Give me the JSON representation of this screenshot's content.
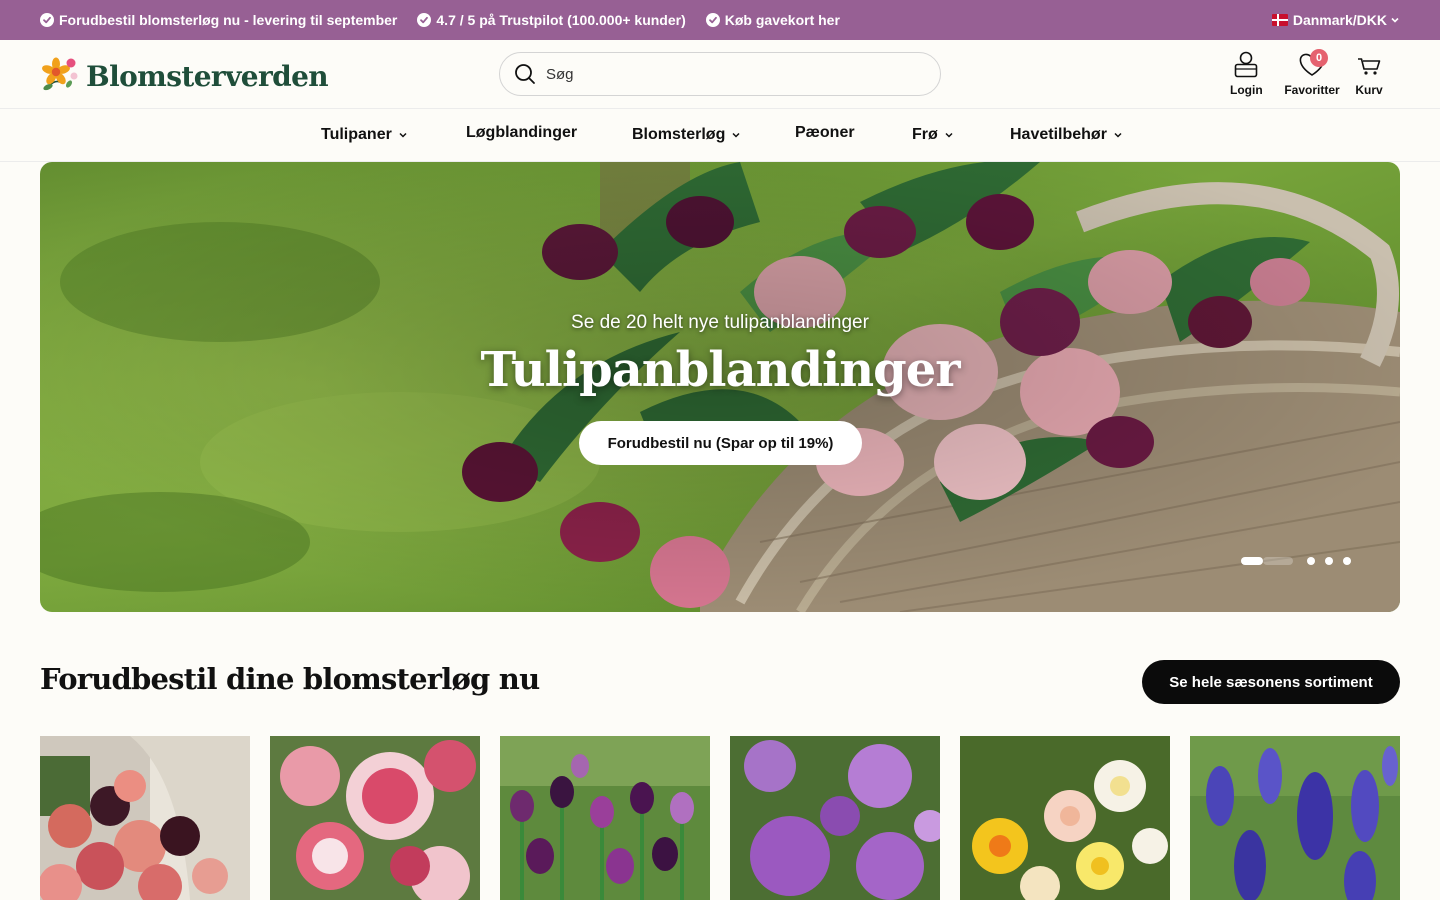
{
  "topbar": {
    "usps": [
      "Forudbestil blomsterløg nu - levering til september",
      "4.7 / 5 på Trustpilot (100.000+ kunder)",
      "Køb gavekort her"
    ],
    "country": "Danmark/DKK",
    "background_color": "#976094"
  },
  "header": {
    "logo_text": "Blomsterverden",
    "logo_color": "#1f4e3a",
    "search_placeholder": "Søg",
    "login_label": "Login",
    "favorites_label": "Favoritter",
    "favorites_count": "0",
    "cart_label": "Kurv",
    "icons": [
      "search-icon",
      "user-icon",
      "heart-icon",
      "cart-icon"
    ]
  },
  "nav": {
    "items": [
      {
        "label": "Tulipaner",
        "has_dropdown": true
      },
      {
        "label": "Løgblandinger",
        "has_dropdown": false
      },
      {
        "label": "Blomsterløg",
        "has_dropdown": true
      },
      {
        "label": "Pæoner",
        "has_dropdown": false
      },
      {
        "label": "Frø",
        "has_dropdown": true
      },
      {
        "label": "Havetilbehør",
        "has_dropdown": true
      }
    ]
  },
  "hero": {
    "subtitle": "Se de 20 helt nye tulipanblandinger",
    "title": "Tulipanblandinger",
    "cta": "Forudbestil nu (Spar op til 19%)",
    "slide_count": 4,
    "active_slide": 1
  },
  "section": {
    "title": "Forudbestil dine blomsterløg nu",
    "see_all": "Se hele sæsonens sortiment"
  },
  "products": [
    {
      "image": "tulip-bouquet-photo"
    },
    {
      "image": "pink-white-double-tulips-photo"
    },
    {
      "image": "purple-tulip-field-photo"
    },
    {
      "image": "purple-allium-photo"
    },
    {
      "image": "daffodil-mix-photo"
    },
    {
      "image": "blue-muscari-photo"
    }
  ],
  "colors": {
    "accent_purple": "#976094",
    "badge_red": "#e5626f",
    "button_black": "#0b0b0b"
  }
}
